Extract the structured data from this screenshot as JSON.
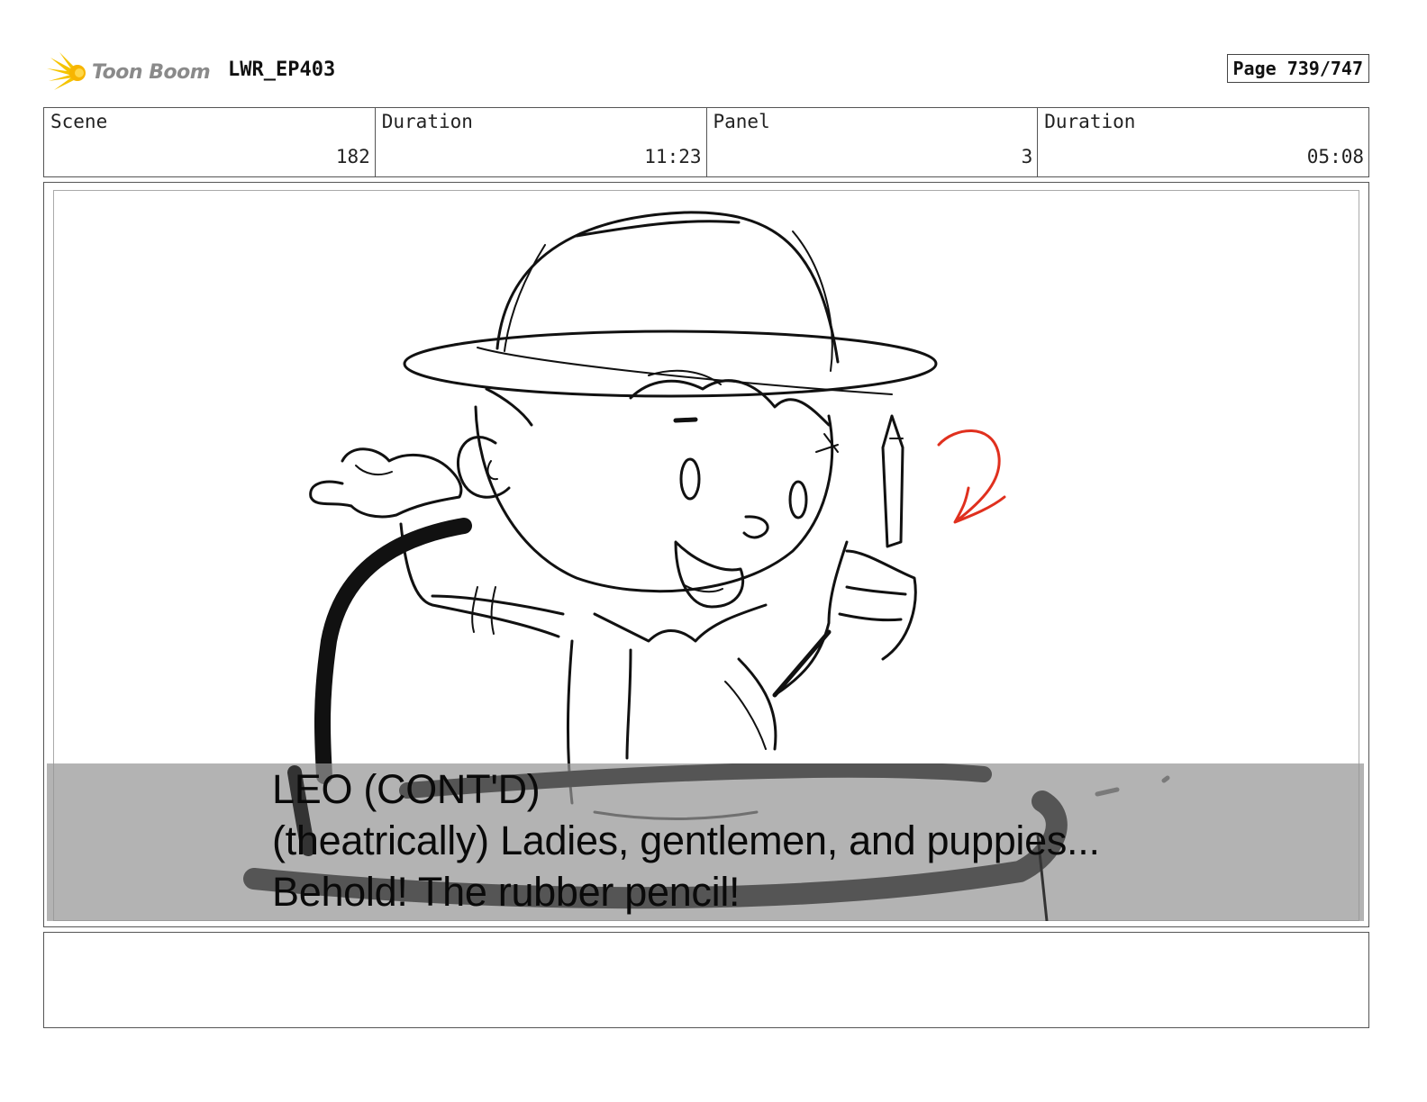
{
  "header": {
    "logo_text": "Toon Boom",
    "project": "LWR_EP403",
    "page": "Page 739/747"
  },
  "info": {
    "scene_label": "Scene",
    "scene_value": "182",
    "scene_duration_label": "Duration",
    "scene_duration_value": "11:23",
    "panel_label": "Panel",
    "panel_value": "3",
    "panel_duration_label": "Duration",
    "panel_duration_value": "05:08"
  },
  "caption": {
    "line1": "LEO (CONT'D)",
    "line2": "(theatrically) Ladies, gentlemen, and puppies...",
    "line3": "Behold! The rubber pencil!"
  },
  "colors": {
    "logo_accent": "#f5c400",
    "annotation_red": "#e0301e"
  }
}
